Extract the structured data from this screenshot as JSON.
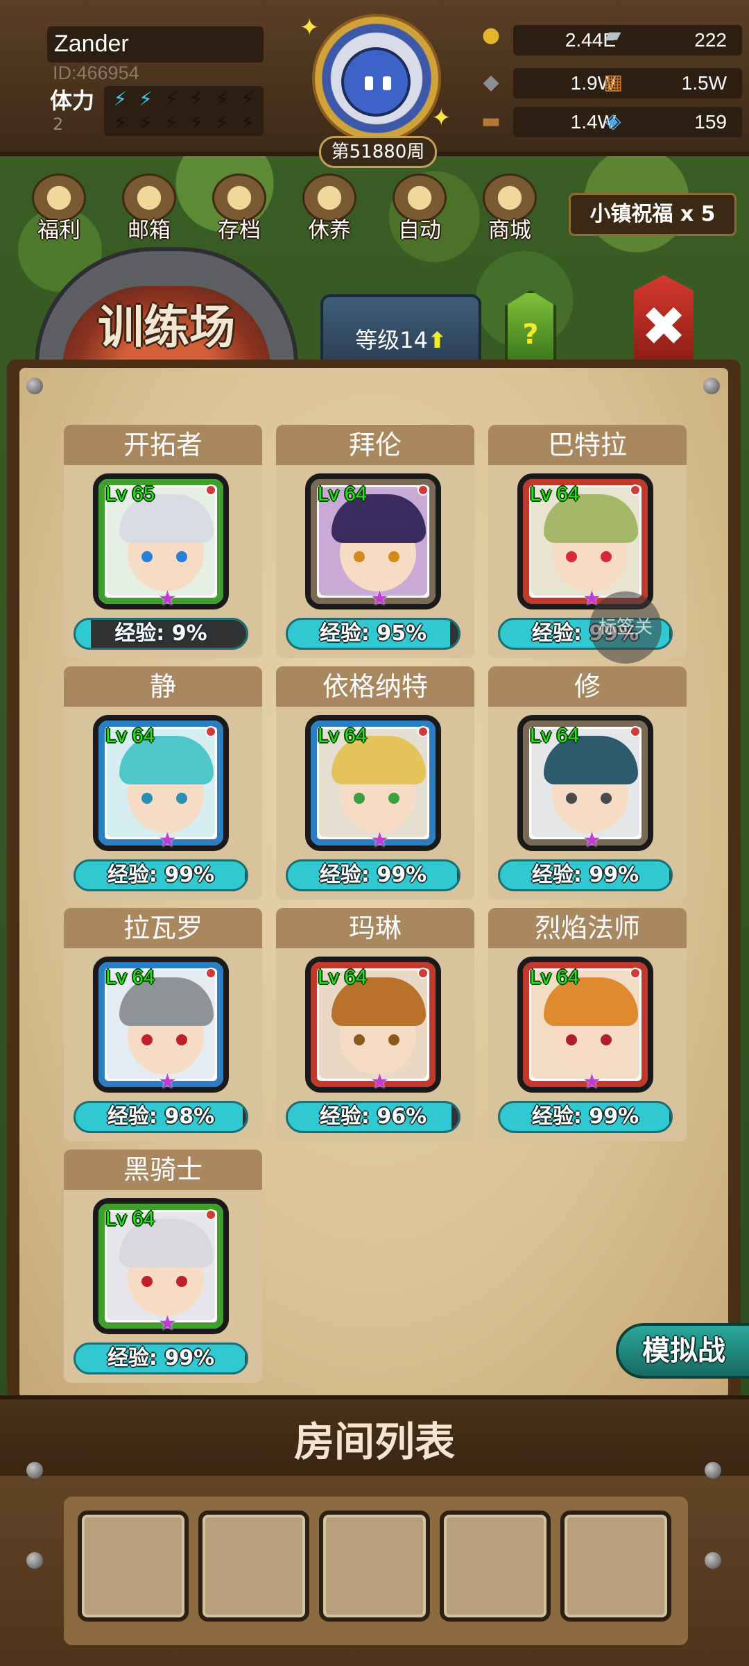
{
  "player": {
    "name": "Zander",
    "id": "ID:466954",
    "stamina_label": "体力",
    "stamina_value": "2"
  },
  "week_label": "第51880周",
  "resources": [
    {
      "icon": "gold-coin-icon",
      "value": "2.44E"
    },
    {
      "icon": "iron-ingot-icon",
      "value": "222"
    },
    {
      "icon": "stone-ore-icon",
      "value": "1.9W"
    },
    {
      "icon": "leather-hide-icon",
      "value": "1.5W"
    },
    {
      "icon": "wood-log-icon",
      "value": "1.4W"
    },
    {
      "icon": "blue-crystal-icon",
      "value": "159"
    }
  ],
  "menu": [
    {
      "label": "福利",
      "icon": "welfare-shield-icon"
    },
    {
      "label": "邮箱",
      "icon": "mail-icon"
    },
    {
      "label": "存档",
      "icon": "save-scroll-icon"
    },
    {
      "label": "休养",
      "icon": "rest-scroll-icon"
    },
    {
      "label": "自动",
      "icon": "auto-map-icon"
    },
    {
      "label": "商城",
      "icon": "shop-icon"
    }
  ],
  "blessing": "小镇祝福 x 5",
  "tab": {
    "title": "训练场",
    "level": "等级14",
    "help": "?",
    "close": "✖"
  },
  "heroes": [
    {
      "name": "开拓者",
      "lv": "Lv 65",
      "exp": "经验: 9%",
      "exp_fraction": 0.09,
      "frame": "#3e9f2d",
      "hair": "#d9dde3",
      "eye": "#2a7fd6",
      "bg": "#e6efe3"
    },
    {
      "name": "拜伦",
      "lv": "Lv 64",
      "exp": "经验: 95%",
      "exp_fraction": 0.95,
      "frame": "#7a6a55",
      "hair": "#3a2c5e",
      "eye": "#d48a1a",
      "bg": "#c9a9d6"
    },
    {
      "name": "巴特拉",
      "lv": "Lv 64",
      "exp": "经验: 99%",
      "exp_fraction": 0.99,
      "frame": "#c0392b",
      "hair": "#a5b86a",
      "eye": "#d62a3a",
      "bg": "#e8e4cf"
    },
    {
      "name": "静",
      "lv": "Lv 64",
      "exp": "经验: 99%",
      "exp_fraction": 0.99,
      "frame": "#2a7fc4",
      "hair": "#4fc7c9",
      "eye": "#2a8fb0",
      "bg": "#d6eef2"
    },
    {
      "name": "依格纳特",
      "lv": "Lv 64",
      "exp": "经验: 99%",
      "exp_fraction": 0.99,
      "frame": "#2a7fc4",
      "hair": "#e3c35a",
      "eye": "#3aa03a",
      "bg": "#e5dfd3"
    },
    {
      "name": "修",
      "lv": "Lv 64",
      "exp": "经验: 99%",
      "exp_fraction": 0.99,
      "frame": "#7a6a55",
      "hair": "#2d5a6c",
      "eye": "#4a4a4a",
      "bg": "#e4e6e8"
    },
    {
      "name": "拉瓦罗",
      "lv": "Lv 64",
      "exp": "经验: 98%",
      "exp_fraction": 0.98,
      "frame": "#2a7fc4",
      "hair": "#8f9397",
      "eye": "#c0202a",
      "bg": "#e4ecf2"
    },
    {
      "name": "玛琳",
      "lv": "Lv 64",
      "exp": "经验: 96%",
      "exp_fraction": 0.96,
      "frame": "#c0392b",
      "hair": "#b8722a",
      "eye": "#8a5a1a",
      "bg": "#e9d8c4"
    },
    {
      "name": "烈焰法师",
      "lv": "Lv 64",
      "exp": "经验: 99%",
      "exp_fraction": 0.99,
      "frame": "#c0392b",
      "hair": "#e08a30",
      "eye": "#b0202a",
      "bg": "#f2dcc6"
    },
    {
      "name": "黑骑士",
      "lv": "Lv 64",
      "exp": "经验: 99%",
      "exp_fraction": 0.99,
      "frame": "#3e9f2d",
      "hair": "#d8d8de",
      "eye": "#c0202a",
      "bg": "#e6e6ea"
    }
  ],
  "filter_label": "标签关",
  "simulate_button": "模拟战",
  "room_list_title": "房间列表",
  "room_slots": 5
}
